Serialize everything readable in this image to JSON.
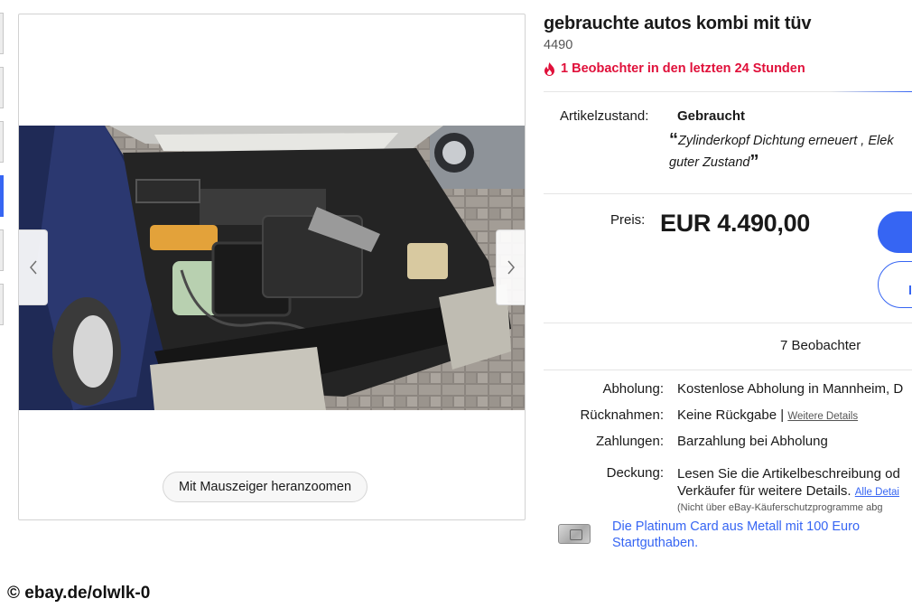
{
  "listing": {
    "title": "gebrauchte autos kombi mit tüv",
    "subtitle": "4490",
    "hot_watchers": "1 Beobachter in den letzten 24 Stunden"
  },
  "gallery": {
    "zoom_hint": "Mit Mauszeiger heranzoomen",
    "prev_icon": "chevron-left-icon",
    "next_icon": "chevron-right-icon"
  },
  "condition": {
    "label": "Artikelzustand:",
    "value": "Gebraucht",
    "quote_open": "“",
    "quote_line1": "Zylinderkopf Dichtung erneuert , Elek",
    "quote_line2": "guter Zustand",
    "quote_close": "”"
  },
  "price": {
    "label": "Preis:",
    "value": "EUR 4.490,00"
  },
  "watchers": {
    "count_text": "7 Beobachter"
  },
  "details": {
    "pickup_label": "Abholung:",
    "pickup_value": "Kostenlose Abholung in Mannheim, D",
    "returns_label": "Rücknahmen:",
    "returns_value": "Keine Rückgabe",
    "returns_sep": "|",
    "returns_link": "Weitere Details",
    "payment_label": "Zahlungen:",
    "payment_value": "Barzahlung bei Abholung",
    "coverage_label": "Deckung:",
    "coverage_line1": "Lesen Sie die Artikelbeschreibung od",
    "coverage_line2": "Verkäufer für weitere Details.",
    "coverage_link": "Alle Detai",
    "coverage_note": "(Nicht über eBay-Käuferschutzprogramme abg"
  },
  "promo": {
    "text": "Die Platinum Card aus Metall mit 100 Euro Startguthaben."
  },
  "watermark": "© ebay.de/olwlk-0",
  "colors": {
    "accent": "#3665f3",
    "hot": "#e0103a"
  }
}
